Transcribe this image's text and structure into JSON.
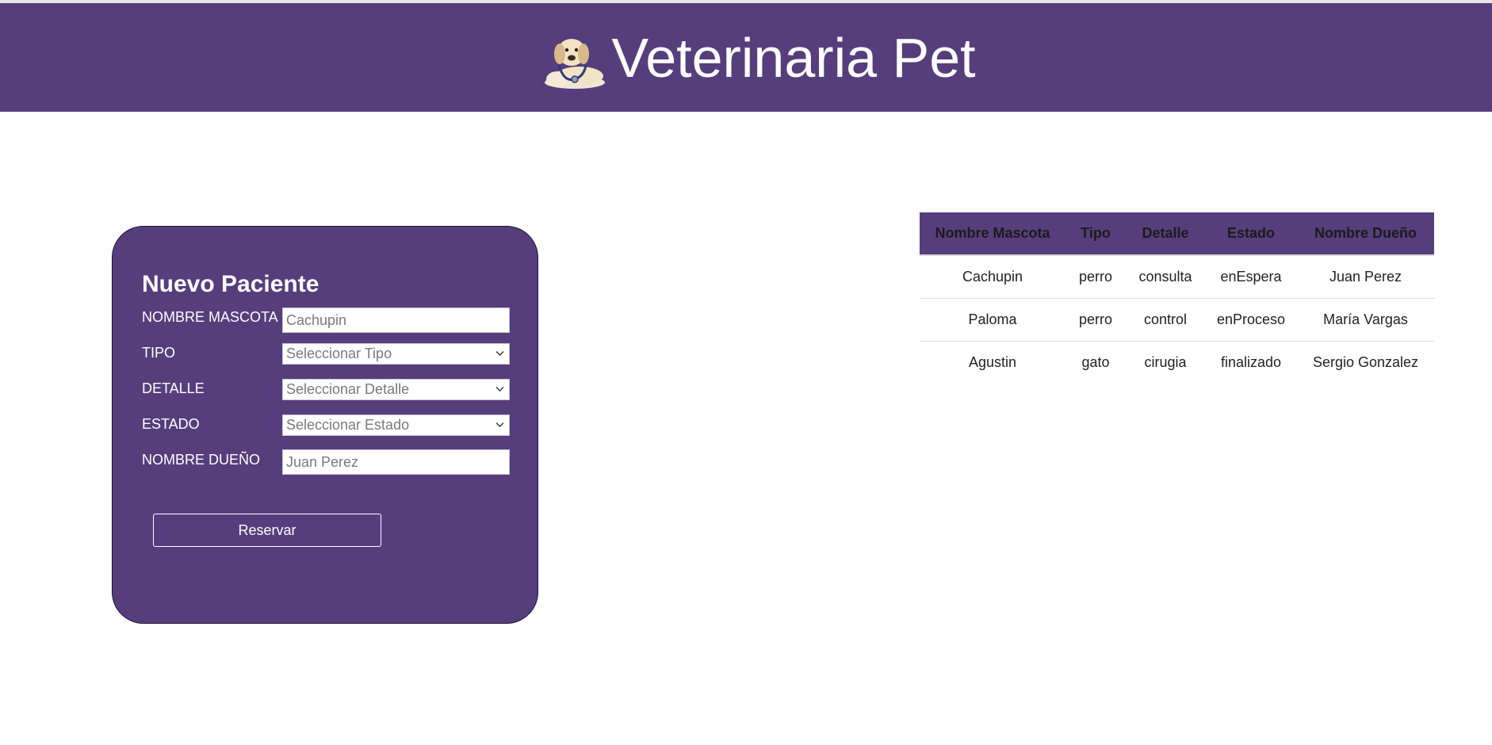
{
  "header": {
    "title": "Veterinaria Pet",
    "logo_icon": "dog-with-stethoscope-icon",
    "background_color": "#563e7c"
  },
  "form": {
    "title": "Nuevo Paciente",
    "fields": {
      "nombre_mascota": {
        "label": "NOMBRE MASCOTA",
        "placeholder": "Cachupin"
      },
      "tipo": {
        "label": "TIPO",
        "selected": "Seleccionar Tipo"
      },
      "detalle": {
        "label": "DETALLE",
        "selected": "Seleccionar Detalle"
      },
      "estado": {
        "label": "ESTADO",
        "selected": "Seleccionar Estado"
      },
      "nombre_dueno": {
        "label": "NOMBRE DUEÑO",
        "placeholder": "Juan Perez"
      }
    },
    "submit_label": "Reservar"
  },
  "table": {
    "columns": [
      "Nombre Mascota",
      "Tipo",
      "Detalle",
      "Estado",
      "Nombre Dueño"
    ],
    "rows": [
      [
        "Cachupin",
        "perro",
        "consulta",
        "enEspera",
        "Juan Perez"
      ],
      [
        "Paloma",
        "perro",
        "control",
        "enProceso",
        "María Vargas"
      ],
      [
        "Agustin",
        "gato",
        "cirugia",
        "finalizado",
        "Sergio Gonzalez"
      ]
    ]
  }
}
